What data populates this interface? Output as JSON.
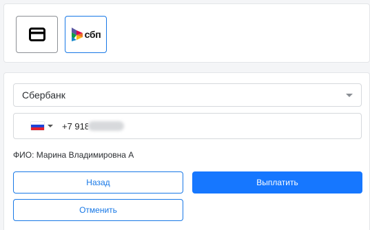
{
  "payment_methods": [
    {
      "name": "card",
      "icon": "credit-card-icon"
    },
    {
      "name": "sbp",
      "icon": "sbp-logo-icon",
      "label": "сбп"
    }
  ],
  "bank_select": {
    "value": "Сбербанк"
  },
  "phone": {
    "country_icon": "russia-flag-icon",
    "value": "+7 918"
  },
  "fio": "ФИО: Марина Владимировна А",
  "buttons": {
    "back": "Назад",
    "pay": "Выплатить",
    "cancel": "Отменить"
  },
  "colors": {
    "accent": "#1677ff",
    "border": "#d5d8dc"
  }
}
